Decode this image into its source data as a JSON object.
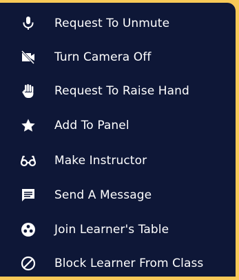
{
  "menu": {
    "items": [
      {
        "label": "Request To Unmute",
        "icon": "microphone-icon"
      },
      {
        "label": "Turn Camera Off",
        "icon": "camera-off-icon"
      },
      {
        "label": "Request To Raise Hand",
        "icon": "hand-icon"
      },
      {
        "label": "Add To Panel",
        "icon": "star-icon"
      },
      {
        "label": "Make Instructor",
        "icon": "glasses-icon"
      },
      {
        "label": "Send A Message",
        "icon": "message-icon"
      },
      {
        "label": "Join Learner's Table",
        "icon": "table-icon"
      },
      {
        "label": "Block Learner From Class",
        "icon": "block-icon"
      }
    ]
  },
  "colors": {
    "background": "#f8c957",
    "menu_background": "#0e1737",
    "text": "#ffffff",
    "accent_marker": "#d33a2b"
  }
}
